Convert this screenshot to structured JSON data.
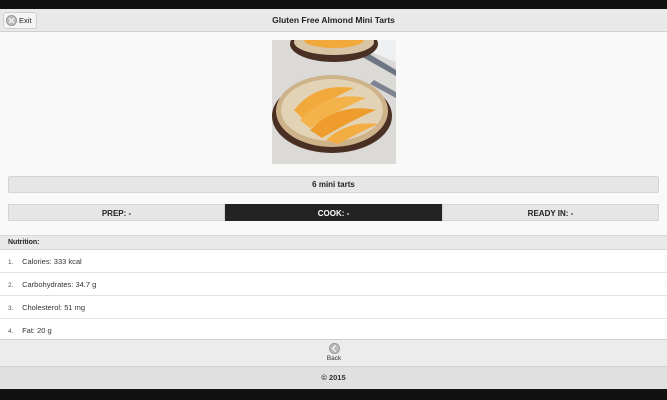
{
  "header": {
    "exit_label": "Exit",
    "title": "Gluten Free Almond Mini Tarts"
  },
  "recipe": {
    "yield": "6 mini tarts",
    "times": [
      {
        "label": "PREP: -",
        "active": false
      },
      {
        "label": "COOK: -",
        "active": true
      },
      {
        "label": "READY IN: -",
        "active": false
      }
    ]
  },
  "nutrition": {
    "heading": "Nutrition:",
    "items": [
      {
        "num": "1.",
        "text": "Calories: 333 kcal"
      },
      {
        "num": "2.",
        "text": "Carbohydrates: 34.7 g"
      },
      {
        "num": "3.",
        "text": "Cholesterol: 51 mg"
      },
      {
        "num": "4.",
        "text": "Fat: 20 g"
      }
    ]
  },
  "nav": {
    "back_label": "Back"
  },
  "footer": {
    "copyright": "© 2015"
  },
  "colors": {
    "active_tab": "#232323",
    "header_bg": "#e9e9e9",
    "peach": "#f2a93b",
    "crust": "#4a2f24"
  },
  "icons": {
    "exit": "close-circle-icon",
    "back": "back-arrow-circle-icon"
  }
}
